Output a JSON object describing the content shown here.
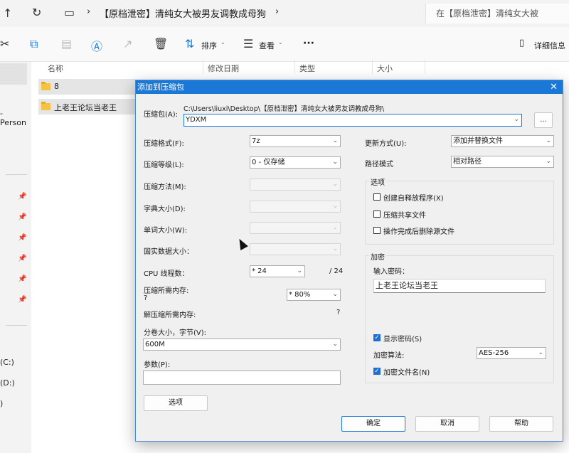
{
  "explorer": {
    "breadcrumb_title": "【原档泄密】清纯女大被男友调教成母狗",
    "search_placeholder": "在【原档泄密】清纯女大被",
    "toolbar": {
      "sort_label": "排序",
      "view_label": "查看",
      "more_label": "···",
      "details_label": "详细信息"
    },
    "columns": [
      "名称",
      "修改日期",
      "类型",
      "大小"
    ],
    "files": [
      {
        "name": "8",
        "type": "folder"
      },
      {
        "name": "上老王论坛当老王",
        "type": "folder"
      }
    ],
    "left_partial_label": "- Person",
    "drives": [
      "(C:)",
      "(D:)",
      ")"
    ]
  },
  "dialog": {
    "title": "添加到压缩包",
    "close_glyph": "✕",
    "archive_label": "压缩包(A):",
    "archive_path": "C:\\Users\\liuxi\\Desktop\\【原档泄密】清纯女大被男友调教成母狗\\",
    "archive_name": "YDXM",
    "browse_label": "...",
    "format_label": "压缩格式(F):",
    "format_value": "7z",
    "level_label": "压缩等级(L):",
    "level_value": "0 - 仅存储",
    "method_label": "压缩方法(M):",
    "dict_label": "字典大小(D):",
    "word_label": "单词大小(W):",
    "solid_label": "固实数据大小：",
    "cpu_label": "CPU 线程数：",
    "cpu_value": "* 24",
    "cpu_total": "/ 24",
    "mem_comp_label": "压缩所需内存:",
    "mem_comp_value": "?",
    "mem_comp_pct": "* 80%",
    "mem_decomp_label": "解压缩所需内存:",
    "mem_decomp_value": "?",
    "volume_label": "分卷大小，字节(V):",
    "volume_value": "600M",
    "params_label": "参数(P):",
    "params_value": "",
    "options_button": "选项",
    "update_label": "更新方式(U):",
    "update_value": "添加并替换文件",
    "path_label": "路径模式",
    "path_value": "相对路径",
    "options_group": "选项",
    "opt_sfx": "创建自释放程序(X)",
    "opt_shared": "压缩共享文件",
    "opt_delete": "操作完成后删除源文件",
    "encrypt_group": "加密",
    "password_label": "输入密码：",
    "password_value": "上老王论坛当老王",
    "show_password": "显示密码(S)",
    "enc_method_label": "加密算法:",
    "enc_method_value": "AES-256",
    "enc_names": "加密文件名(N)",
    "ok_button": "确定",
    "cancel_button": "取消",
    "help_button": "帮助"
  },
  "colors": {
    "accent": "#1c78d6",
    "folder": "#f5c242"
  }
}
